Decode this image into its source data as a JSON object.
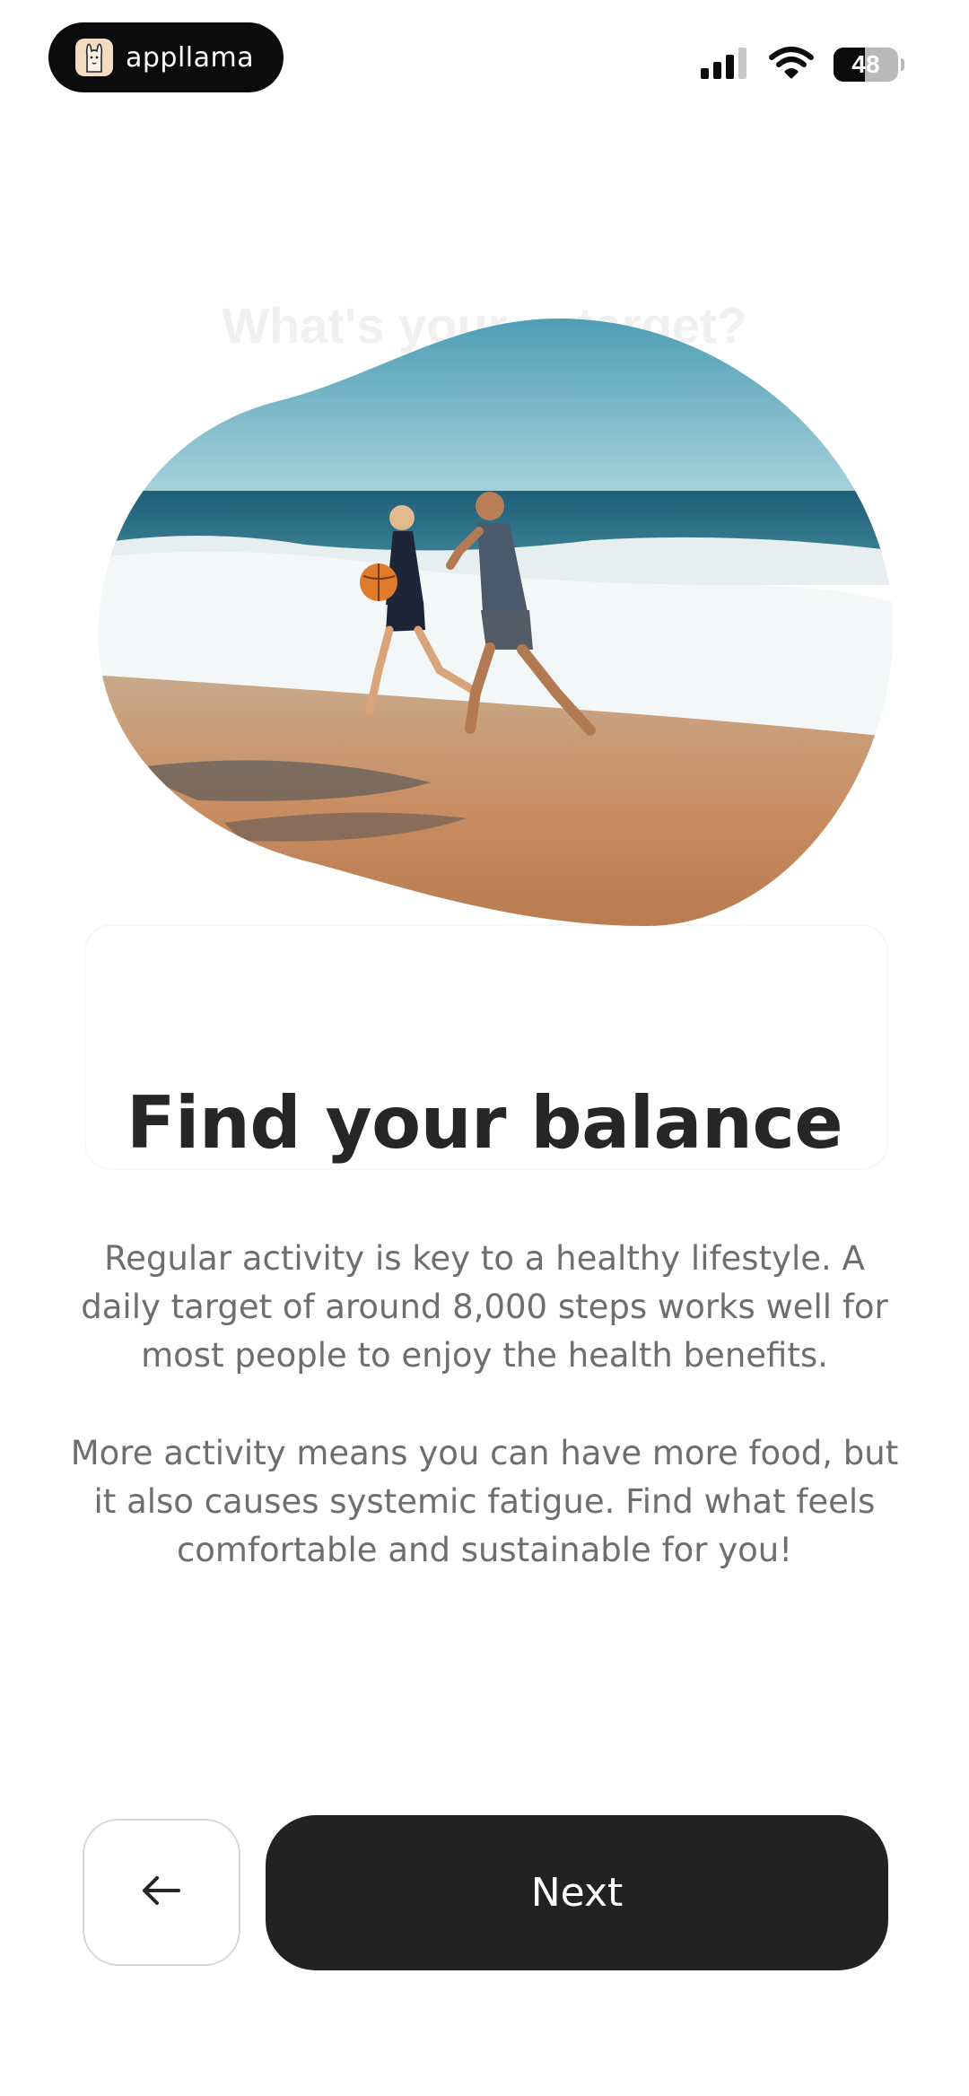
{
  "status_bar": {
    "app_name": "appllama",
    "battery_level": "48",
    "battery_percent": 48,
    "icons": [
      "cellular-signal-icon",
      "wifi-icon",
      "battery-icon"
    ]
  },
  "background": {
    "ghost_heading": "What's your ... target?"
  },
  "hero_image": {
    "description_icon": "beach-photo"
  },
  "main": {
    "title": "Find your balance",
    "paragraph_1": "Regular activity is key to a healthy lifestyle. A daily target of around 8,000 steps works well for most people to enjoy the health benefits.",
    "paragraph_2": "More activity means you can have more food, but it also causes systemic fatigue. Find what feels comfortable and sustainable for you!"
  },
  "footer": {
    "back_icon": "arrow-left-icon",
    "next_label": "Next"
  },
  "colors": {
    "primary_dark": "#222222",
    "text_dark": "#262626",
    "text_muted": "#6e6e6e"
  }
}
